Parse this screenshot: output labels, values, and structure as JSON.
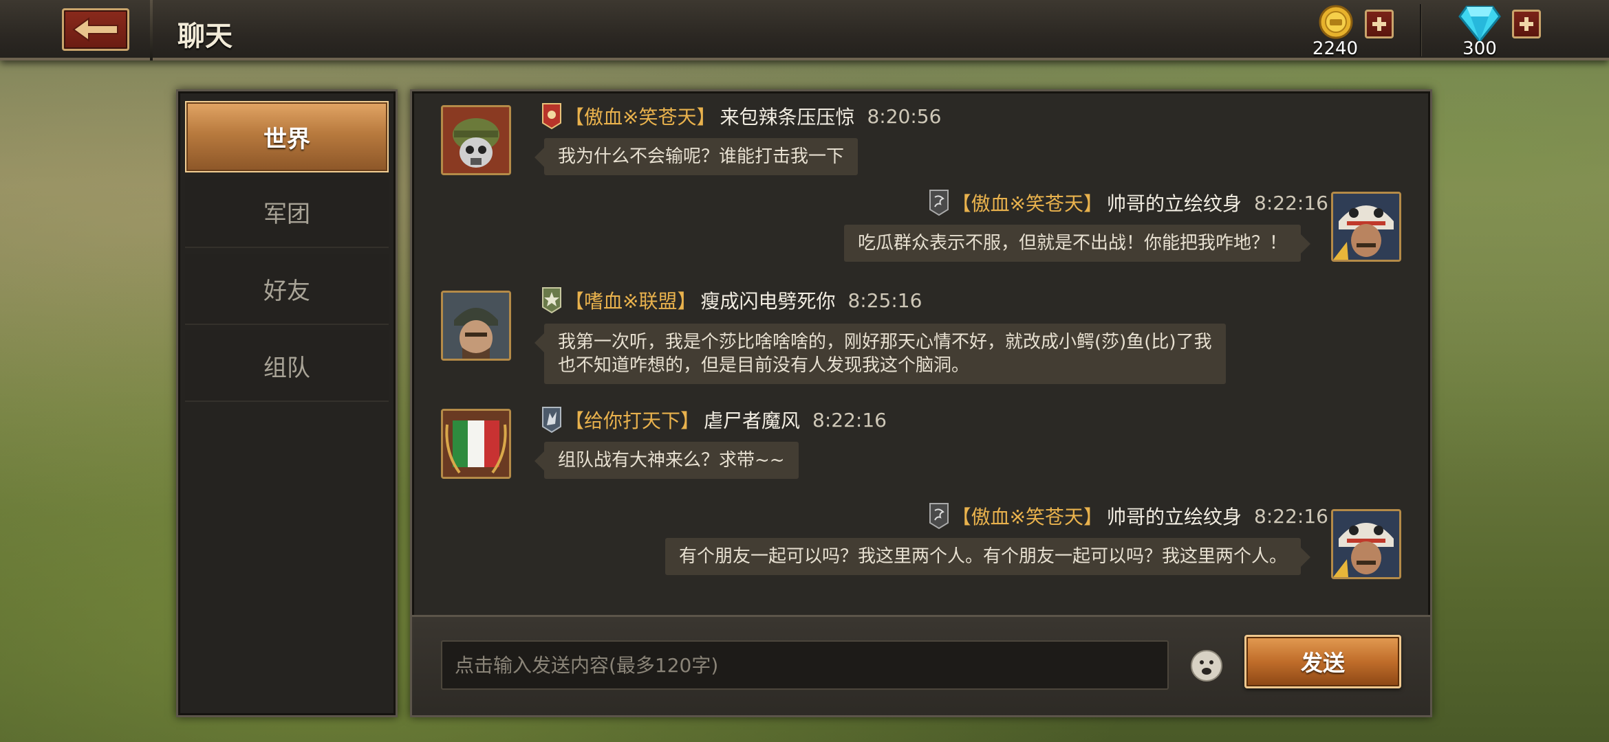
{
  "header": {
    "title": "聊天",
    "gold": {
      "amount": "2240",
      "icon": "gold-coin-icon"
    },
    "diamond": {
      "amount": "300",
      "icon": "diamond-icon"
    }
  },
  "tabs": [
    {
      "label": "世界",
      "active": true
    },
    {
      "label": "军团",
      "active": false
    },
    {
      "label": "好友",
      "active": false
    },
    {
      "label": "组队",
      "active": false
    }
  ],
  "messages": [
    {
      "side": "left",
      "guild": "【傲血※笑苍天】",
      "player": "来包辣条压压惊",
      "time": "8:20:56",
      "text": [
        "我为什么不会输呢？谁能打击我一下"
      ],
      "avatar": "soldier-gasmask-avatar",
      "badge": "red-rank-badge"
    },
    {
      "side": "right",
      "guild": "【傲血※笑苍天】",
      "player": "帅哥的立绘纹身",
      "time": "8:22:16",
      "text": [
        "吃瓜群众表示不服，但就是不出战！你能把我咋地？！"
      ],
      "avatar": "lion-dance-avatar",
      "badge": "dragon-badge"
    },
    {
      "side": "left",
      "guild": "【嗜血※联盟】",
      "player": "瘦成闪电劈死你",
      "time": "8:25:16",
      "text": [
        "我第一次听，我是个莎比啥啥啥的，刚好那天心情不好，就改成小鳄(莎)鱼(比)了我",
        "也不知道咋想的，但是目前没有人发现我这个脑洞。"
      ],
      "avatar": "soldier-helmet-avatar",
      "badge": "star-badge"
    },
    {
      "side": "left",
      "guild": "【给你打天下】",
      "player": "虐尸者魔风",
      "time": "8:22:16",
      "text": [
        "组队战有大神来么？求带~~"
      ],
      "avatar": "italy-flag-avatar",
      "badge": "wolf-badge"
    },
    {
      "side": "right",
      "guild": "【傲血※笑苍天】",
      "player": "帅哥的立绘纹身",
      "time": "8:22:16",
      "text": [
        "有个朋友一起可以吗？我这里两个人。有个朋友一起可以吗？我这里两个人。"
      ],
      "avatar": "lion-dance-avatar",
      "badge": "dragon-badge"
    }
  ],
  "input": {
    "placeholder": "点击输入发送内容(最多120字)",
    "send_label": "发送",
    "emoji_icon": "smiley-icon"
  }
}
